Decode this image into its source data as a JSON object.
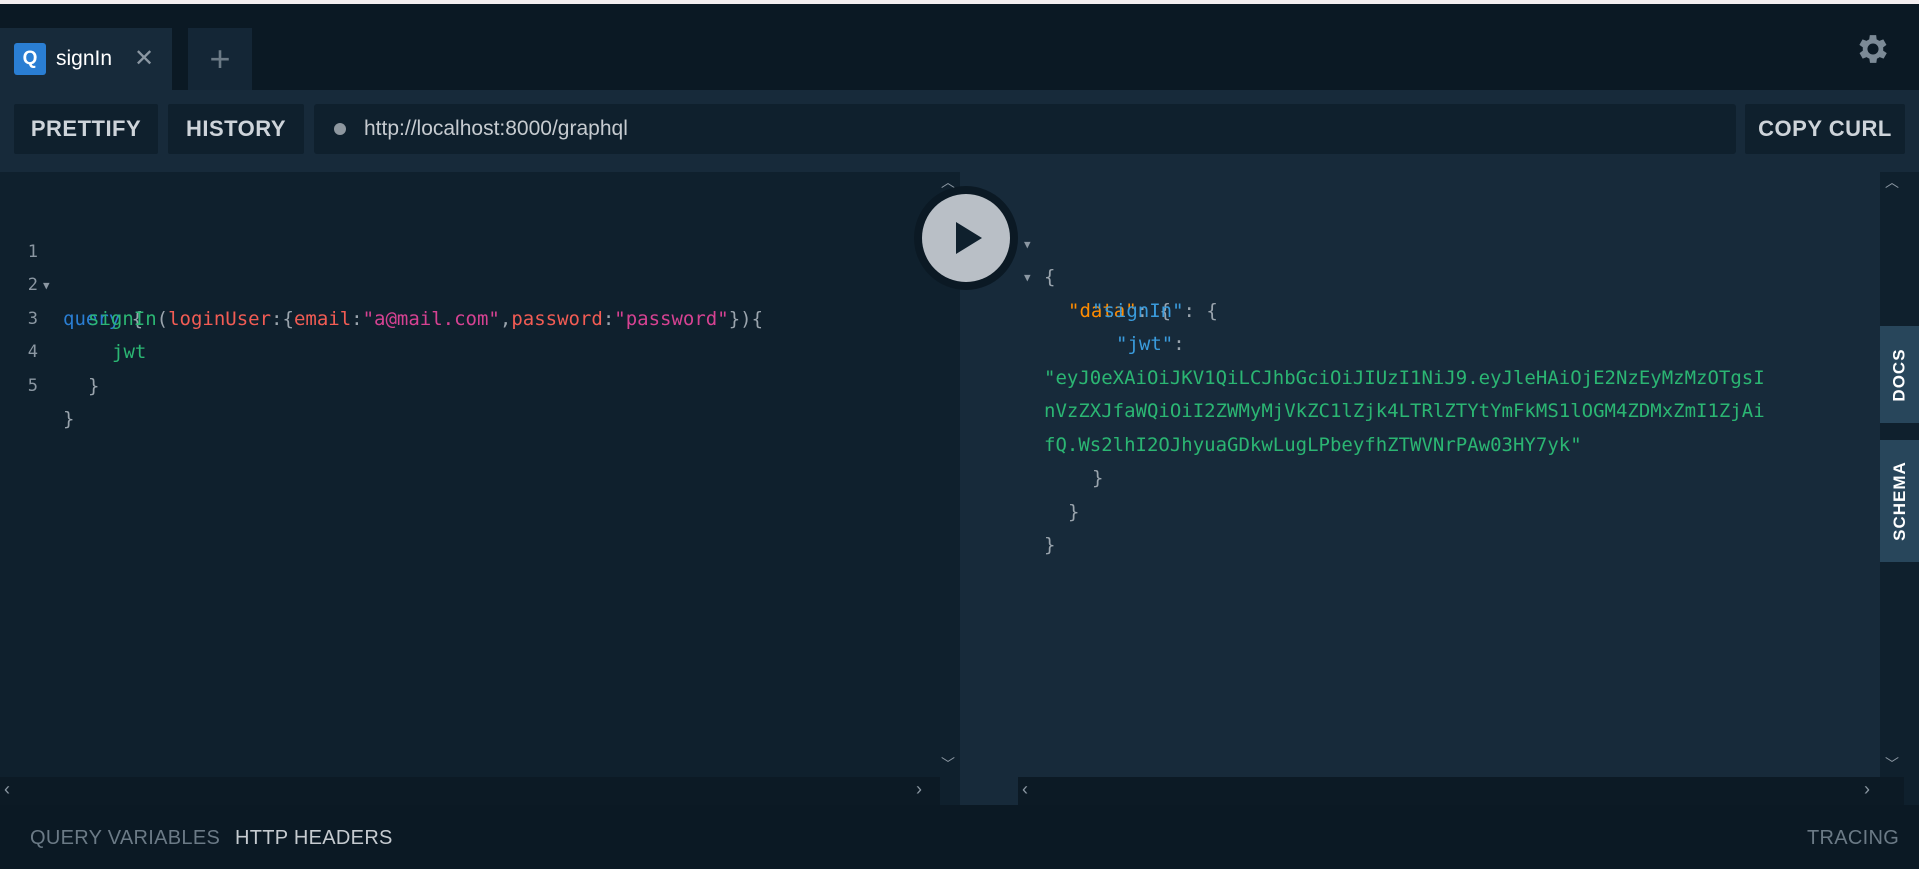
{
  "tabs": [
    {
      "badge": "Q",
      "title": "signIn",
      "close": "✕"
    }
  ],
  "add_tab": "+",
  "toolbar": {
    "prettify": "PRETTIFY",
    "history": "HISTORY",
    "url": "http://localhost:8000/graphql",
    "copy_curl": "COPY CURL"
  },
  "editor": {
    "line_numbers": [
      "1",
      "2",
      "3",
      "4",
      "5"
    ],
    "lines": [
      {
        "query_kw": "query",
        "brace": " {"
      },
      {
        "field": "signIn",
        "p1": "(",
        "arg": "loginUser",
        "p2": ":{",
        "k1": "email",
        "c1": ":",
        "v1": "\"a@mail.com\"",
        "comma": ",",
        "k2": "password",
        "c2": ":",
        "v2": "\"password\"",
        "p3": "}){"
      },
      {
        "field": "jwt"
      },
      {
        "brace": "}"
      },
      {
        "brace": "}"
      }
    ]
  },
  "result": {
    "open_brace": "{",
    "data_key": "\"data\"",
    "colon_brace": ": {",
    "signin_key": "\"signIn\"",
    "jwt_key": "\"jwt\"",
    "colon": ":",
    "jwt_lines": [
      "\"eyJ0eXAiOiJKV1QiLCJhbGciOiJIUzI1NiJ9.eyJleHAiOjE2NzEyMzMzOTgsI",
      "nVzZXJfaWQiOiI2ZWMyMjVkZC1lZjk4LTRlZTYtYmFkMS1lOGM4ZDMxZmI1ZjAi",
      "fQ.Ws2lhI2OJhyuaGDkwLugLPbeyfhZTWVNrPAw03HY7yk\""
    ],
    "close_brace": "}"
  },
  "side_tabs": {
    "docs": "DOCS",
    "schema": "SCHEMA"
  },
  "footer": {
    "query_variables": "QUERY VARIABLES",
    "http_headers": "HTTP HEADERS",
    "tracing": "TRACING"
  }
}
